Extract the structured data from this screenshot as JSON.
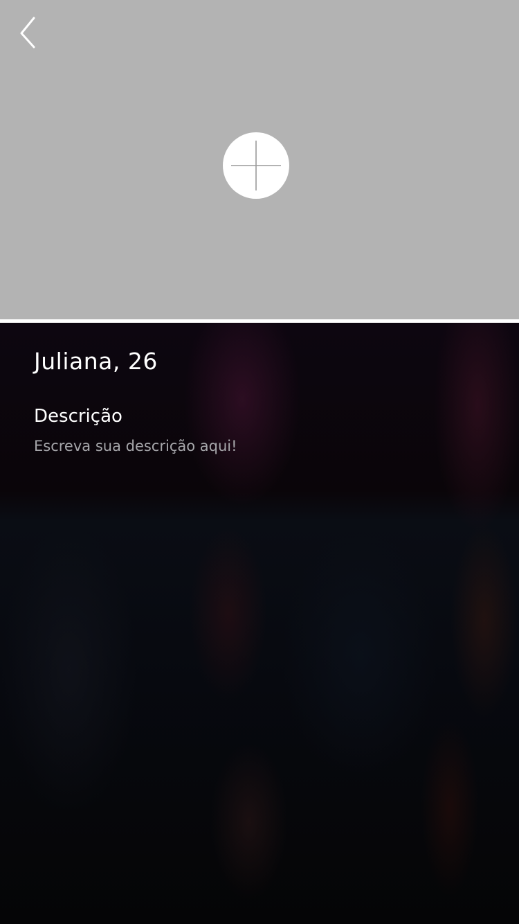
{
  "header": {
    "back_icon": "chevron-left-icon",
    "add_photo_icon": "plus-icon",
    "photo_background_color": "#b3b3b3"
  },
  "profile": {
    "name_age": "Juliana, 26",
    "description_title": "Descrição",
    "description_placeholder": "Escreva sua descrição aqui!"
  }
}
